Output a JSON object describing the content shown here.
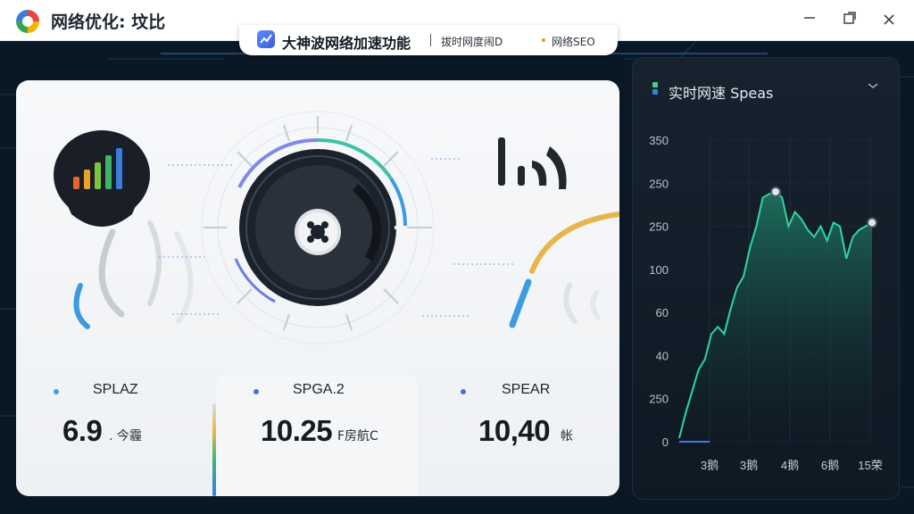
{
  "window": {
    "title": "网络优化: 坟比",
    "minimize_icon": "minimize-icon",
    "maximize_icon": "maximize-icon",
    "close_icon": "close-icon"
  },
  "tab_strip": {
    "title": "大神波网络加速功能",
    "sub1": "拔时网度闹D",
    "sub2": "网络SEO"
  },
  "stats": [
    {
      "label": "SPLAZ",
      "value": "6.9",
      "unit": ". 今霾",
      "dot_color": "#3aa0e8"
    },
    {
      "label": "SPGA.2",
      "value": "10.25",
      "unit": "F房航C",
      "dot_color": "#4a72d8"
    },
    {
      "label": "SPEAR",
      "value": "10,40",
      "unit": "帐",
      "dot_color": "#4a72d8"
    }
  ],
  "speed_panel": {
    "title": "实时网速 Speas"
  },
  "chart_data": {
    "type": "area",
    "title": "实时网速 Speas",
    "y_tick_labels": [
      "350",
      "250",
      "250",
      "100",
      "60",
      "40",
      "250",
      "0"
    ],
    "x_tick_labels": [
      "3鹅",
      "3鹅",
      "4鹅",
      "6鹅",
      "15荣"
    ],
    "series": [
      {
        "values": [
          5,
          40,
          70,
          100,
          115,
          150,
          160,
          150,
          185,
          215,
          230,
          270,
          300,
          340,
          345,
          348,
          340,
          300,
          320,
          310,
          295,
          285,
          300,
          280,
          305,
          300,
          255,
          285,
          295,
          300,
          305
        ]
      }
    ],
    "ylim": [
      0,
      420
    ],
    "grid": true,
    "colors": {
      "line": "#2fd6a0",
      "fill_top": "#1f7a64",
      "fill_bottom": "#0f1924"
    }
  }
}
